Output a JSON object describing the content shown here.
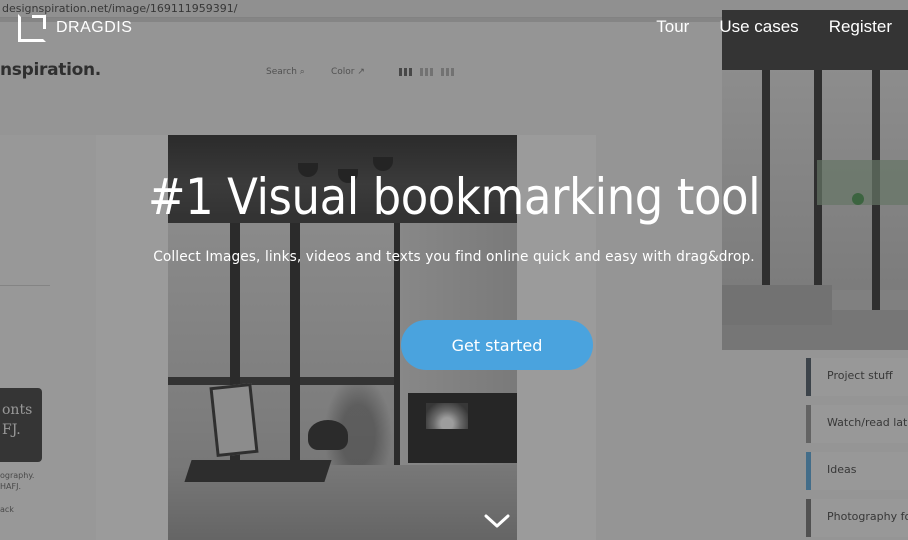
{
  "background": {
    "url": "designspiration.net/image/169111959391/",
    "brand": "nspiration.",
    "search": "Search",
    "color": "Color",
    "fonts_card_line1": "onts",
    "fonts_card_line2": "FJ.",
    "small_caption_1": "ography.",
    "small_caption_2": "HAFJ.",
    "small_caption_3": "ack",
    "collections": [
      {
        "label": "Project stuff"
      },
      {
        "label": "Watch/read later"
      },
      {
        "label": "Ideas"
      },
      {
        "label": "Photography for"
      }
    ]
  },
  "header": {
    "logo_text": "DRAGDIS",
    "nav": [
      {
        "label": "Tour"
      },
      {
        "label": "Use cases"
      },
      {
        "label": "Register"
      }
    ]
  },
  "hero": {
    "title": "#1 Visual bookmarking tool",
    "subtitle": "Collect Images, links, videos and texts you find online quick and easy with drag&drop.",
    "cta_label": "Get started"
  },
  "colors": {
    "accent": "#4aa3de",
    "overlay": "#3c3c3c"
  },
  "icons": {
    "logo": "dragdis-logo-icon",
    "scroll": "chevron-down-icon"
  }
}
